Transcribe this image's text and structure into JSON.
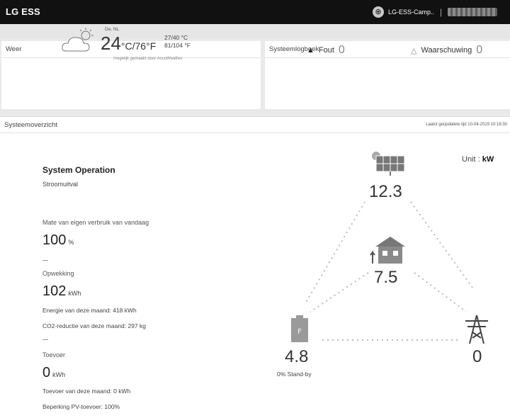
{
  "app": {
    "title": "LG ESS"
  },
  "account": {
    "device_name": "LG-ESS-Camp..",
    "separator": "|"
  },
  "weather": {
    "panel_title": "Weer",
    "city": "De, NL",
    "temperature": "24",
    "temperature_units": "°C/76°F",
    "range_c": "27/40 °C",
    "range_f": "81/104 °F",
    "source": "mogelijk gemaakt door AccuWeather"
  },
  "logbook": {
    "panel_title": "Systeemlogboek",
    "error_label": "Fout",
    "error_count": "0",
    "warning_label": "Waarschuwing",
    "warning_count": "0"
  },
  "overview": {
    "panel_title": "Systeemoverzicht",
    "last_updated": "Laatst geüpdatete tijd 10-04-2019 10:18:30",
    "unit_label": "Unit :",
    "unit_value": "kW",
    "operation_title": "System Operation",
    "operation_status": "Stroomuitval",
    "self_consumption_label": "Mate van eigen verbruik van vandaag",
    "self_consumption_value": "100",
    "self_consumption_unit": "%",
    "generation_label": "Opwekking",
    "generation_value": "102",
    "generation_unit": "kWh",
    "generation_month": "Energie van deze maand: 418 kWh",
    "co2_month": "CO2-reductie van deze maand: 297 kg",
    "feed_label": "Toevoer",
    "feed_value": "0",
    "feed_unit": "kWh",
    "feed_month": "Toevoer van deze maand: 0 kWh",
    "pv_limit": "Beperking PV-toevoer: 100%"
  },
  "flow": {
    "solar_value": "12.3",
    "home_value": "7.5",
    "battery_value": "4.8",
    "battery_status": "0% Stand-by",
    "grid_value": "0"
  }
}
